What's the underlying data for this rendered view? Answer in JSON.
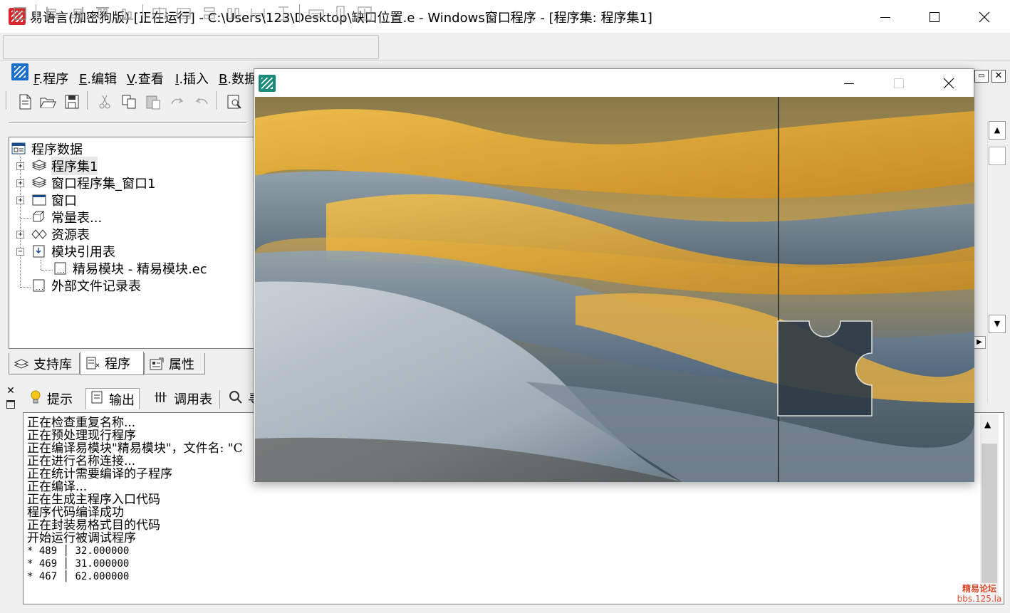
{
  "window": {
    "title": "易语言(加密狗版) [正在运行] - C:\\Users\\123\\Desktop\\缺口位置.e - Windows窗口程序 - [程序集: 程序集1]"
  },
  "menu": {
    "items": [
      {
        "key": "F",
        "label": ".程序"
      },
      {
        "key": "E",
        "label": ".编辑"
      },
      {
        "key": "V",
        "label": ".查看"
      },
      {
        "key": "I",
        "label": ".插入"
      },
      {
        "key": "B",
        "label": ".数据"
      }
    ]
  },
  "tree": {
    "root": "程序数据",
    "items": [
      {
        "label": "程序集1"
      },
      {
        "label": "窗口程序集_窗口1"
      },
      {
        "label": "窗口"
      },
      {
        "label": "常量表..."
      },
      {
        "label": "资源表"
      },
      {
        "label": "模块引用表"
      },
      {
        "label": "精易模块 - 精易模块.ec"
      },
      {
        "label": "外部文件记录表"
      }
    ]
  },
  "bottom_tabs": {
    "support": "支持库",
    "program": "程序",
    "properties": "属性"
  },
  "output_tabs": {
    "hint": "提示",
    "output": "输出",
    "calltable": "调用表",
    "search_partial": "寻"
  },
  "output": {
    "lines": [
      "正在检查重复名称...",
      "正在预处理现行程序",
      "正在编译易模块\"精易模块\"，文件名: \"C",
      "正在进行名称连接...",
      "正在统计需要编译的子程序",
      "正在编译...",
      "正在生成主程序入口代码",
      "程序代码编译成功",
      "正在封装易格式目的代码",
      "开始运行被调试程序"
    ],
    "debug_rows": [
      {
        "id": "489",
        "value": "32.000000"
      },
      {
        "id": "469",
        "value": "31.000000"
      },
      {
        "id": "467",
        "value": "62.000000"
      }
    ]
  },
  "watermark": {
    "line1": "精易论坛",
    "line2": "bbs.125.la"
  },
  "colors": {
    "title_icon": "#d9262c",
    "menu_icon": "#1a6fc9",
    "popup_icon": "#1a8a7a",
    "watermark": "#d84a2a"
  }
}
